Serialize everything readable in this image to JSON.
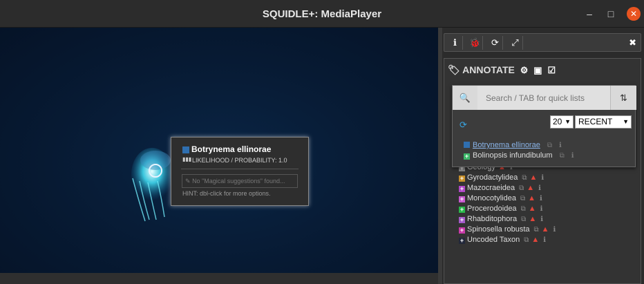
{
  "window": {
    "title": "SQUIDLE+: MediaPlayer",
    "min": "–",
    "max": "□",
    "close": "✕"
  },
  "popup": {
    "name": "Botrynema ellinorae",
    "color": "#2f6fb0",
    "likelihood": "LIKELIHOOD / PROBABILITY: 1.0",
    "suggestions": "No \"Magical suggestions\" found...",
    "hint": "HINT: dbl-click for more options."
  },
  "toolbar": {
    "info": "ℹ",
    "bug": "🐞",
    "refresh": "⟳",
    "expand": "⤢",
    "close": "✖"
  },
  "annotate": {
    "heading": "ANNOTATE",
    "search_placeholder": "Search / TAB for quick lists",
    "count": "20",
    "list": "RECENT",
    "quick_items": [
      {
        "label": "Botrynema ellinorae",
        "color": "#2f6fb0"
      },
      {
        "label": "Bolinopsis infundibulum",
        "color": "#3db86a"
      }
    ],
    "classes": [
      {
        "label": "Geology",
        "color": "#888888"
      },
      {
        "label": "Gyrodactylidea",
        "color": "#c8902a"
      },
      {
        "label": "Mazocraeidea",
        "color": "#b048c8"
      },
      {
        "label": "Monocotylidea",
        "color": "#c85ad0"
      },
      {
        "label": "Procerodoidea",
        "color": "#2ab84a"
      },
      {
        "label": "Rhabditophora",
        "color": "#a45ac8"
      },
      {
        "label": "Spinosella robusta",
        "color": "#c83aa8"
      },
      {
        "label": "Uncoded Taxon",
        "color": "#22283a"
      }
    ]
  }
}
